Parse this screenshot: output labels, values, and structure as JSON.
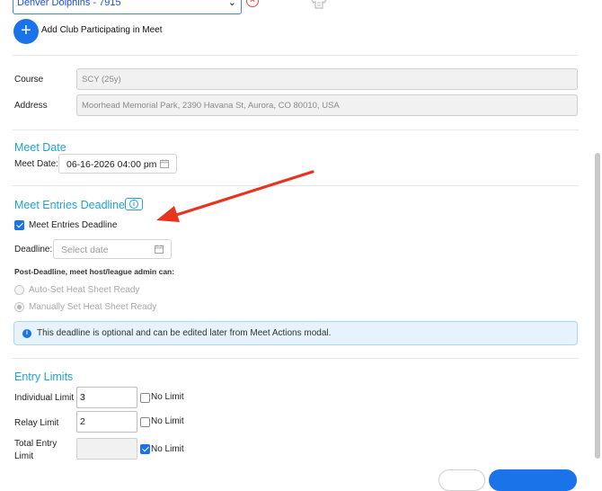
{
  "club": {
    "selected": "Denver Dolphins - 7915"
  },
  "add_club": {
    "icon": "+",
    "label": "Add Club Participating in Meet"
  },
  "course": {
    "label": "Course",
    "value": "SCY (25y)"
  },
  "address": {
    "label": "Address",
    "value": "Moorhead Memorial Park, 2390 Havana St, Aurora, CO 80010, USA"
  },
  "meet_date": {
    "title": "Meet Date",
    "label": "Meet Date:",
    "value": "06-16-2026 04:00 pm"
  },
  "entries_deadline": {
    "title": "Meet Entries Deadline",
    "checkbox_label": "Meet Entries Deadline",
    "checked": true,
    "deadline_label": "Deadline:",
    "deadline_placeholder": "Select date",
    "post_deadline_label": "Post-Deadline, meet host/league admin can:",
    "options": [
      {
        "label": "Auto-Set Heat Sheet Ready",
        "selected": false
      },
      {
        "label": "Manually Set Heat Sheet Ready",
        "selected": true
      }
    ],
    "info_text": "This deadline is optional and can be edited later from Meet Actions modal."
  },
  "entry_limits": {
    "title": "Entry Limits",
    "rows": [
      {
        "label": "Individual Limit",
        "value": "3",
        "no_limit_label": "No Limit",
        "no_limit": false
      },
      {
        "label": "Relay Limit",
        "value": "2",
        "no_limit_label": "No Limit",
        "no_limit": false
      },
      {
        "label": "Total Entry Limit",
        "value": "",
        "no_limit_label": "No Limit",
        "no_limit": true
      }
    ]
  },
  "colors": {
    "accent": "#1a73e8",
    "heading": "#20a4d8",
    "annotation_arrow": "#e8341f"
  }
}
